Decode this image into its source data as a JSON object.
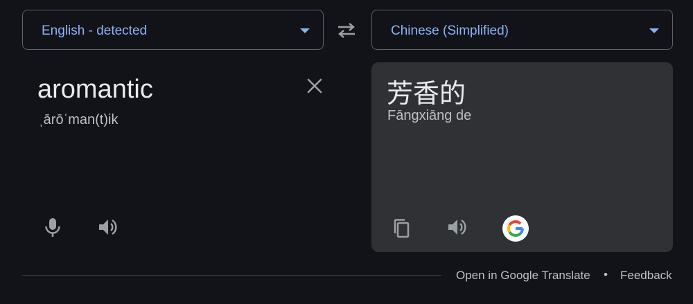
{
  "source_language": {
    "label": "English - detected"
  },
  "target_language": {
    "label": "Chinese (Simplified)"
  },
  "source": {
    "text": "aromantic",
    "phonetic": "ˌārōˈman(t)ik"
  },
  "target": {
    "text": "芳香的",
    "romanization": "Fāngxiāng de"
  },
  "footer": {
    "open_link": "Open in Google Translate",
    "separator": "•",
    "feedback_link": "Feedback"
  },
  "icons": {
    "swap": "swap-arrows-icon",
    "clear": "close-icon",
    "mic": "microphone-icon",
    "speaker": "speaker-icon",
    "copy": "copy-icon",
    "logo": "google-logo-icon"
  },
  "colors": {
    "background": "#121318",
    "accent": "#8ab4f8",
    "panel": "#303134",
    "border": "#5f6368",
    "icon": "#9aa0a6"
  }
}
